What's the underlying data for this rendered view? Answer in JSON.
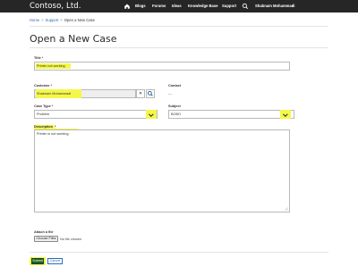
{
  "navbar": {
    "brand": "Contoso, Ltd.",
    "links": [
      "Blogs",
      "Forums",
      "Ideas",
      "Knowledge Base",
      "Support"
    ],
    "user": "Shabnam Mohammadi"
  },
  "breadcrumb": {
    "home": "Home",
    "support": "Support",
    "current": "Open a New Case",
    "separator": ">"
  },
  "page_title": "Open a New Case",
  "form": {
    "title": {
      "label": "Title",
      "required": "*",
      "value": "Printer not working"
    },
    "customer": {
      "label": "Customer",
      "required": "*",
      "value": "Shabnam Mohammadi"
    },
    "contact": {
      "label": "Contact",
      "value": "---"
    },
    "case_type": {
      "label": "Case Type",
      "required": "*",
      "value": "Problem"
    },
    "subject": {
      "label": "Subject",
      "value": "BOBO"
    },
    "description": {
      "label": "Description",
      "required": "*",
      "value": "Printer is not working."
    },
    "attach": {
      "label": "Attach a file",
      "button": "Choose Files",
      "status": "No file chosen"
    }
  },
  "actions": {
    "submit": "Submit",
    "cancel": "Cancel"
  },
  "colors": {
    "navbar": "#262626",
    "highlight": "#f4f74a",
    "submit": "#1f5f1f",
    "link": "#2b6cb0"
  }
}
